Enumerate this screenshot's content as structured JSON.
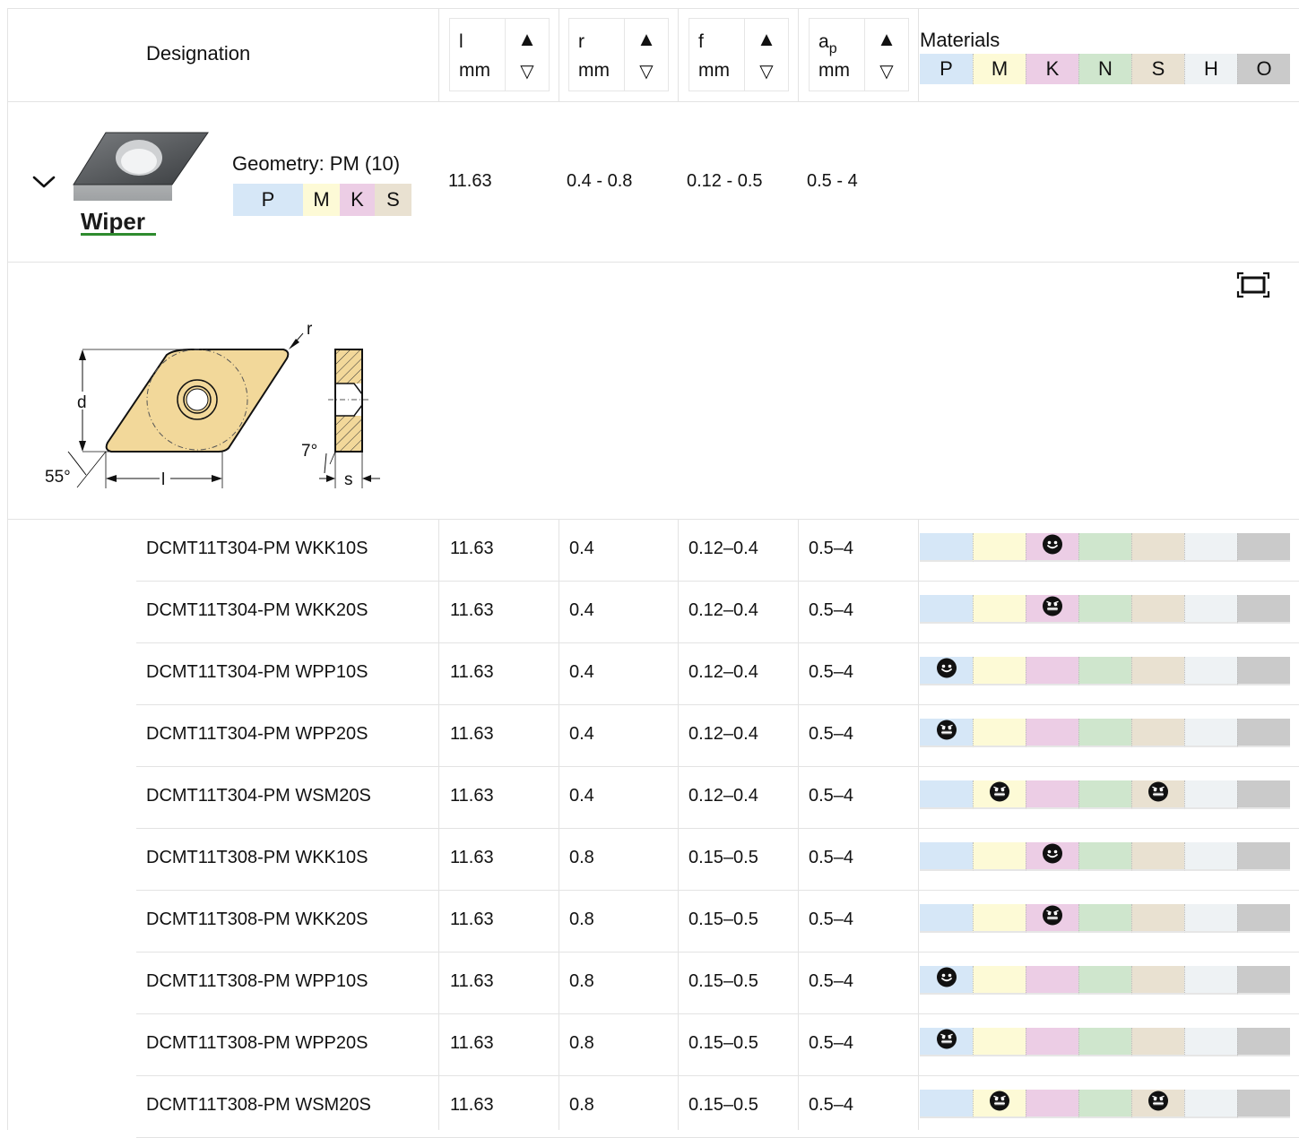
{
  "header": {
    "designation": "Designation",
    "materials": "Materials",
    "sort_up": "▲",
    "sort_down": "▽",
    "columns": [
      {
        "label": "l",
        "sub": "",
        "unit": "mm"
      },
      {
        "label": "r",
        "sub": "",
        "unit": "mm"
      },
      {
        "label": "f",
        "sub": "",
        "unit": "mm"
      },
      {
        "label": "a",
        "sub": "p",
        "unit": "mm"
      }
    ],
    "material_codes": [
      "P",
      "M",
      "K",
      "N",
      "S",
      "H",
      "O"
    ]
  },
  "colors": {
    "P": "#d6e7f7",
    "M": "#fdfad6",
    "K": "#eccde5",
    "N": "#cfe6cd",
    "S": "#e9e1d1",
    "H": "#eef2f4",
    "O": "#cacaca",
    "insert_fill": "#f2d89a",
    "wiper_green": "#2e8b2e"
  },
  "group": {
    "expand_icon": "chevron-down-icon",
    "geometry_label": "Geometry: PM (10)",
    "geometry_materials": [
      "P",
      "M",
      "K",
      "S"
    ],
    "wiper_label": "Wiper",
    "l": "11.63",
    "r": "0.4 - 0.8",
    "f": "0.12 - 0.5",
    "ap": "0.5 - 4"
  },
  "drawing": {
    "fullscreen_icon": "fullscreen-icon",
    "label_r": "r",
    "label_d": "d",
    "label_l": "l",
    "label_s": "s",
    "label_angle_55": "55°",
    "label_angle_7": "7°"
  },
  "rows": [
    {
      "designation": "DCMT11T304-PM WKK10S",
      "l": "11.63",
      "r": "0.4",
      "f": "0.12–0.4",
      "ap": "0.5–4",
      "suit": {
        "K": "good"
      }
    },
    {
      "designation": "DCMT11T304-PM WKK20S",
      "l": "11.63",
      "r": "0.4",
      "f": "0.12–0.4",
      "ap": "0.5–4",
      "suit": {
        "K": "ok"
      }
    },
    {
      "designation": "DCMT11T304-PM WPP10S",
      "l": "11.63",
      "r": "0.4",
      "f": "0.12–0.4",
      "ap": "0.5–4",
      "suit": {
        "P": "good"
      }
    },
    {
      "designation": "DCMT11T304-PM WPP20S",
      "l": "11.63",
      "r": "0.4",
      "f": "0.12–0.4",
      "ap": "0.5–4",
      "suit": {
        "P": "ok"
      }
    },
    {
      "designation": "DCMT11T304-PM WSM20S",
      "l": "11.63",
      "r": "0.4",
      "f": "0.12–0.4",
      "ap": "0.5–4",
      "suit": {
        "M": "ok",
        "S": "ok"
      }
    },
    {
      "designation": "DCMT11T308-PM WKK10S",
      "l": "11.63",
      "r": "0.8",
      "f": "0.15–0.5",
      "ap": "0.5–4",
      "suit": {
        "K": "good"
      }
    },
    {
      "designation": "DCMT11T308-PM WKK20S",
      "l": "11.63",
      "r": "0.8",
      "f": "0.15–0.5",
      "ap": "0.5–4",
      "suit": {
        "K": "ok"
      }
    },
    {
      "designation": "DCMT11T308-PM WPP10S",
      "l": "11.63",
      "r": "0.8",
      "f": "0.15–0.5",
      "ap": "0.5–4",
      "suit": {
        "P": "good"
      }
    },
    {
      "designation": "DCMT11T308-PM WPP20S",
      "l": "11.63",
      "r": "0.8",
      "f": "0.15–0.5",
      "ap": "0.5–4",
      "suit": {
        "P": "ok"
      }
    },
    {
      "designation": "DCMT11T308-PM WSM20S",
      "l": "11.63",
      "r": "0.8",
      "f": "0.15–0.5",
      "ap": "0.5–4",
      "suit": {
        "M": "ok",
        "S": "ok"
      }
    }
  ]
}
